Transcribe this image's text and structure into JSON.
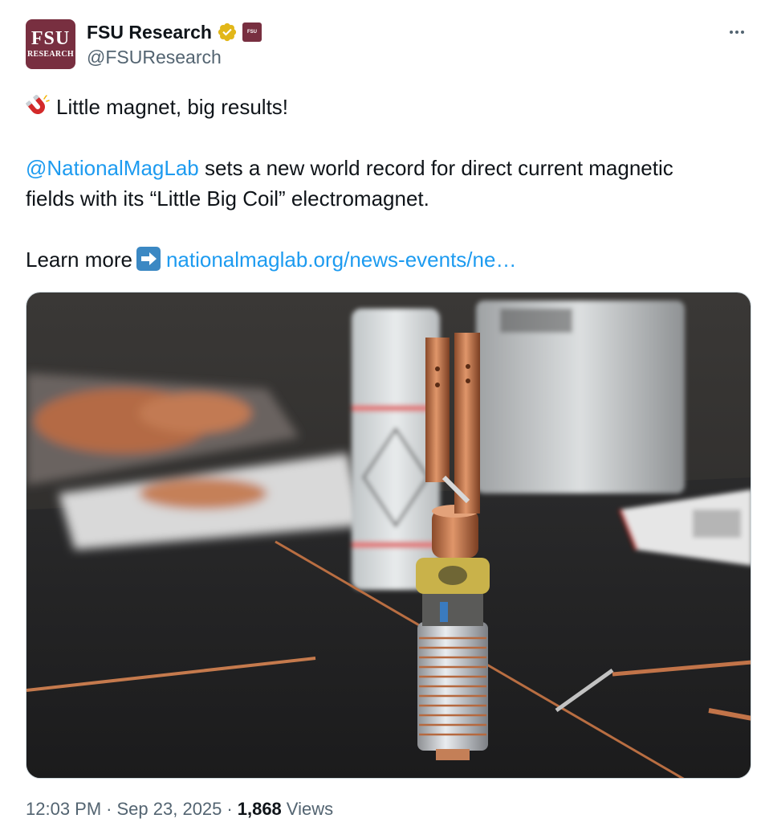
{
  "author": {
    "display_name": "FSU Research",
    "handle": "@FSUResearch",
    "avatar_text_top": "FSU",
    "avatar_text_bottom": "RESEARCH",
    "affiliation_badge_text": "FSU",
    "verified_icon": "verified-gold-badge-icon"
  },
  "tweet": {
    "line1_text": "Little magnet, big results!",
    "mention": "@NationalMagLab",
    "line2_rest": " sets a new world record for direct current magnetic",
    "line3": "fields with its “Little Big Coil” electromagnet.",
    "learn_more": "Learn more",
    "link": "nationalmaglab.org/news-events/ne…"
  },
  "meta": {
    "time": "12:03 PM",
    "separator": "·",
    "date": "Sep 23, 2025",
    "views_count": "1,868",
    "views_label": "Views"
  },
  "colors": {
    "accent": "#1d9bf0",
    "secondary_text": "#536471",
    "brand_garnet": "#782f40",
    "verified_gold": "#e2b719"
  }
}
